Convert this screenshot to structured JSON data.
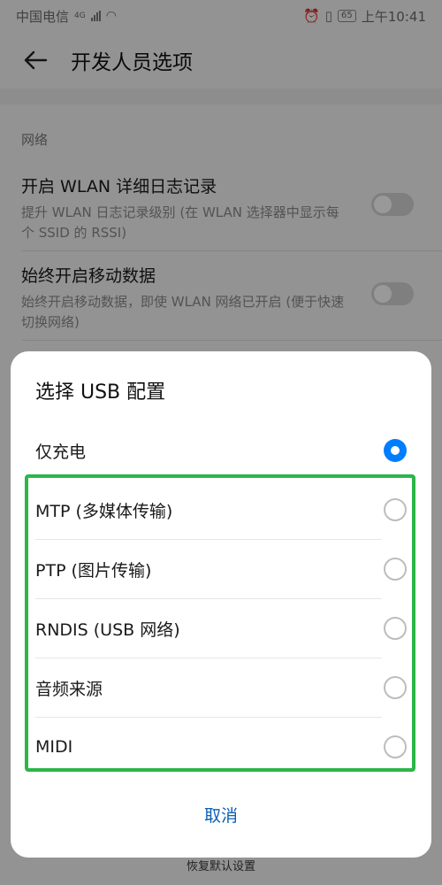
{
  "status_bar": {
    "carrier": "中国电信",
    "network": "4G",
    "battery": "65",
    "time": "上午10:41"
  },
  "app_bar": {
    "title": "开发人员选项"
  },
  "section": {
    "label": "网络"
  },
  "prefs": [
    {
      "title": "开启 WLAN 详细日志记录",
      "subtitle": "提升 WLAN 日志记录级别 (在 WLAN 选择器中显示每个 SSID 的 RSSI)",
      "enabled": false
    },
    {
      "title": "始终开启移动数据",
      "subtitle": "始终开启移动数据，即使 WLAN 网络已开启 (便于快速切换网络)",
      "enabled": false
    }
  ],
  "dialog": {
    "title": "选择 USB 配置",
    "options": [
      {
        "label": "仅充电",
        "selected": true
      },
      {
        "label": "MTP (多媒体传输)",
        "selected": false
      },
      {
        "label": "PTP (图片传输)",
        "selected": false
      },
      {
        "label": "RNDIS (USB 网络)",
        "selected": false
      },
      {
        "label": "音频来源",
        "selected": false
      },
      {
        "label": "MIDI",
        "selected": false
      }
    ],
    "cancel_label": "取消"
  },
  "bottom_action": {
    "label": "恢复默认设置"
  },
  "colors": {
    "accent": "#007dff",
    "highlight": "#2db54a",
    "cancel": "#0a5fb5"
  }
}
